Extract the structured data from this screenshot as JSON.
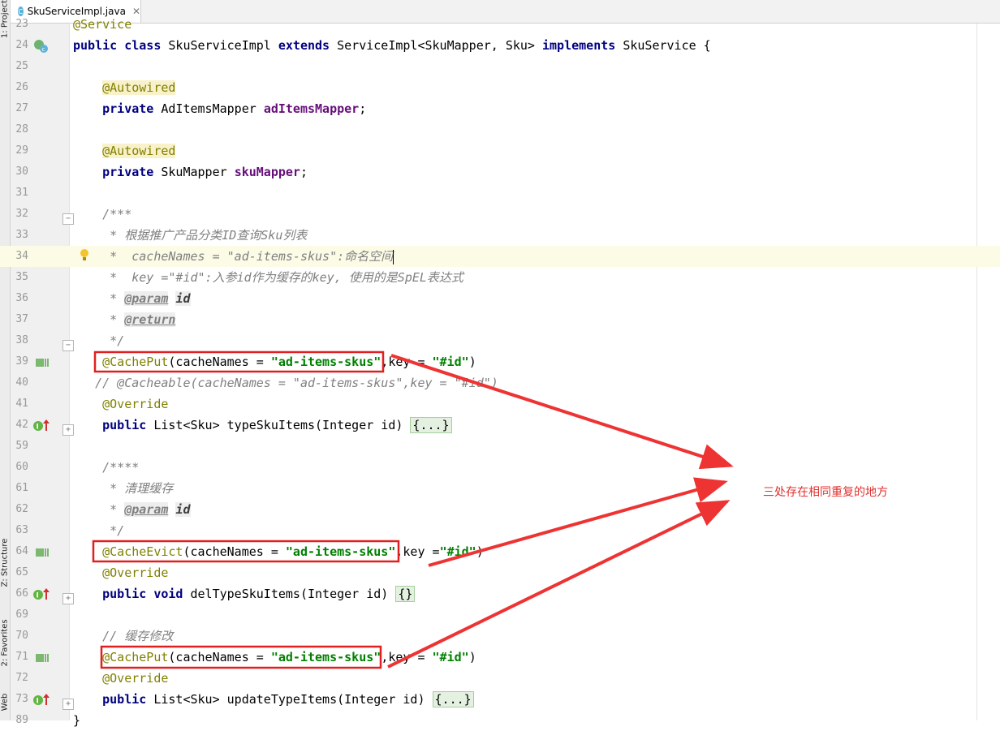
{
  "tab": {
    "filename": "SkuServiceImpl.java"
  },
  "side_tabs": {
    "project": "1: Project",
    "structure": "Z: Structure",
    "favorites": "2: Favorites",
    "web": "Web"
  },
  "annotation_note": "三处存在相同重复的地方",
  "lines": [
    {
      "n": "23",
      "parts": [
        {
          "t": "@Service",
          "c": "ann"
        }
      ]
    },
    {
      "n": "24",
      "parts": [
        {
          "t": "public class ",
          "c": "kw"
        },
        {
          "t": "SkuServiceImpl "
        },
        {
          "t": "extends ",
          "c": "kw"
        },
        {
          "t": "ServiceImpl<SkuMapper, Sku> "
        },
        {
          "t": "implements ",
          "c": "kw"
        },
        {
          "t": "SkuService {"
        }
      ]
    },
    {
      "n": "25",
      "parts": []
    },
    {
      "n": "26",
      "parts": [
        {
          "t": "    "
        },
        {
          "t": "@Autowired",
          "c": "annbg"
        }
      ]
    },
    {
      "n": "27",
      "parts": [
        {
          "t": "    "
        },
        {
          "t": "private ",
          "c": "kw"
        },
        {
          "t": "AdItemsMapper "
        },
        {
          "t": "adItemsMapper",
          "c": "fld"
        },
        {
          "t": ";"
        }
      ]
    },
    {
      "n": "28",
      "parts": []
    },
    {
      "n": "29",
      "parts": [
        {
          "t": "    "
        },
        {
          "t": "@Autowired",
          "c": "annbg"
        }
      ]
    },
    {
      "n": "30",
      "parts": [
        {
          "t": "    "
        },
        {
          "t": "private ",
          "c": "kw"
        },
        {
          "t": "SkuMapper "
        },
        {
          "t": "skuMapper",
          "c": "fld"
        },
        {
          "t": ";"
        }
      ]
    },
    {
      "n": "31",
      "parts": []
    },
    {
      "n": "32",
      "parts": [
        {
          "t": "    /***",
          "c": "cmt"
        }
      ]
    },
    {
      "n": "33",
      "parts": [
        {
          "t": "     * 根据推广产品分类ID查询Sku列表",
          "c": "cmt"
        }
      ]
    },
    {
      "n": "34",
      "parts": [
        {
          "t": "     *  cacheNames = \"ad-items-skus\":命名空间",
          "c": "cmt"
        }
      ]
    },
    {
      "n": "35",
      "parts": [
        {
          "t": "     *  key =\"#id\":入参id作为缓存的key, 使用的是SpEL表达式",
          "c": "cmt"
        }
      ]
    },
    {
      "n": "36",
      "parts": [
        {
          "t": "     * ",
          "c": "cmt"
        },
        {
          "t": "@param",
          "c": "tag"
        },
        {
          "t": " "
        },
        {
          "t": "id",
          "c": "tagv"
        }
      ]
    },
    {
      "n": "37",
      "parts": [
        {
          "t": "     * ",
          "c": "cmt"
        },
        {
          "t": "@return",
          "c": "tag"
        }
      ]
    },
    {
      "n": "38",
      "parts": [
        {
          "t": "     */",
          "c": "cmt"
        }
      ]
    },
    {
      "n": "39",
      "parts": [
        {
          "t": "    "
        },
        {
          "t": "@CachePut",
          "c": "ann"
        },
        {
          "t": "(cacheNames = "
        },
        {
          "t": "\"ad-items-skus\"",
          "c": "str"
        },
        {
          "t": ",key = "
        },
        {
          "t": "\"#id\"",
          "c": "str"
        },
        {
          "t": ")"
        }
      ]
    },
    {
      "n": "40",
      "parts": [
        {
          "t": "   // @Cacheable(cacheNames = \"ad-items-skus\",key = \"#id\")",
          "c": "cmt"
        }
      ]
    },
    {
      "n": "41",
      "parts": [
        {
          "t": "    "
        },
        {
          "t": "@Override",
          "c": "ann"
        }
      ]
    },
    {
      "n": "42",
      "parts": [
        {
          "t": "    "
        },
        {
          "t": "public ",
          "c": "kw"
        },
        {
          "t": "List<Sku> typeSkuItems(Integer id) "
        },
        {
          "t": "{...}",
          "c": "fold"
        }
      ]
    },
    {
      "n": "59",
      "parts": []
    },
    {
      "n": "60",
      "parts": [
        {
          "t": "    /****",
          "c": "cmt"
        }
      ]
    },
    {
      "n": "61",
      "parts": [
        {
          "t": "     * 清理缓存",
          "c": "cmt"
        }
      ]
    },
    {
      "n": "62",
      "parts": [
        {
          "t": "     * ",
          "c": "cmt"
        },
        {
          "t": "@param",
          "c": "tag"
        },
        {
          "t": " "
        },
        {
          "t": "id",
          "c": "tagv"
        }
      ]
    },
    {
      "n": "63",
      "parts": [
        {
          "t": "     */",
          "c": "cmt"
        }
      ]
    },
    {
      "n": "64",
      "parts": [
        {
          "t": "    "
        },
        {
          "t": "@CacheEvict",
          "c": "ann"
        },
        {
          "t": "(cacheNames = "
        },
        {
          "t": "\"ad-items-skus\"",
          "c": "str"
        },
        {
          "t": ",key ="
        },
        {
          "t": "\"#id\"",
          "c": "str"
        },
        {
          "t": ")"
        }
      ]
    },
    {
      "n": "65",
      "parts": [
        {
          "t": "    "
        },
        {
          "t": "@Override",
          "c": "ann"
        }
      ]
    },
    {
      "n": "66",
      "parts": [
        {
          "t": "    "
        },
        {
          "t": "public void ",
          "c": "kw"
        },
        {
          "t": "delTypeSkuItems(Integer id) "
        },
        {
          "t": "{}",
          "c": "fold"
        }
      ]
    },
    {
      "n": "69",
      "parts": []
    },
    {
      "n": "70",
      "parts": [
        {
          "t": "    // 缓存修改",
          "c": "cmt"
        }
      ]
    },
    {
      "n": "71",
      "parts": [
        {
          "t": "    "
        },
        {
          "t": "@CachePut",
          "c": "ann"
        },
        {
          "t": "(cacheNames = "
        },
        {
          "t": "\"ad-items-skus\"",
          "c": "str"
        },
        {
          "t": ",key = "
        },
        {
          "t": "\"#id\"",
          "c": "str"
        },
        {
          "t": ")"
        }
      ]
    },
    {
      "n": "72",
      "parts": [
        {
          "t": "    "
        },
        {
          "t": "@Override",
          "c": "ann"
        }
      ]
    },
    {
      "n": "73",
      "parts": [
        {
          "t": "    "
        },
        {
          "t": "public ",
          "c": "kw"
        },
        {
          "t": "List<Sku> updateTypeItems(Integer id) "
        },
        {
          "t": "{...}",
          "c": "fold"
        }
      ]
    },
    {
      "n": "89",
      "parts": [
        {
          "t": "}"
        }
      ]
    }
  ]
}
